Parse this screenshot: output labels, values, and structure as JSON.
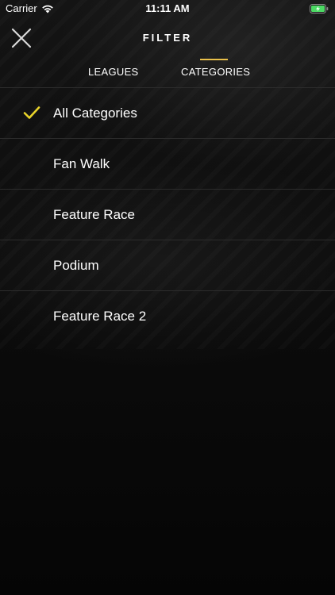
{
  "status_bar": {
    "carrier": "Carrier",
    "time": "11:11 AM",
    "wifi_icon": "wifi-icon",
    "battery_icon": "battery-charging-icon",
    "battery_color": "#4cd964"
  },
  "header": {
    "title": "FILTER",
    "close_icon": "close-icon"
  },
  "tabs": [
    {
      "label": "LEAGUES",
      "selected": false
    },
    {
      "label": "CATEGORIES",
      "selected": true
    }
  ],
  "accent_color": "#e9c04a",
  "categories": [
    {
      "label": "All Categories",
      "selected": true
    },
    {
      "label": "Fan Walk",
      "selected": false
    },
    {
      "label": "Feature Race",
      "selected": false
    },
    {
      "label": "Podium",
      "selected": false
    },
    {
      "label": "Feature Race 2",
      "selected": false
    }
  ]
}
